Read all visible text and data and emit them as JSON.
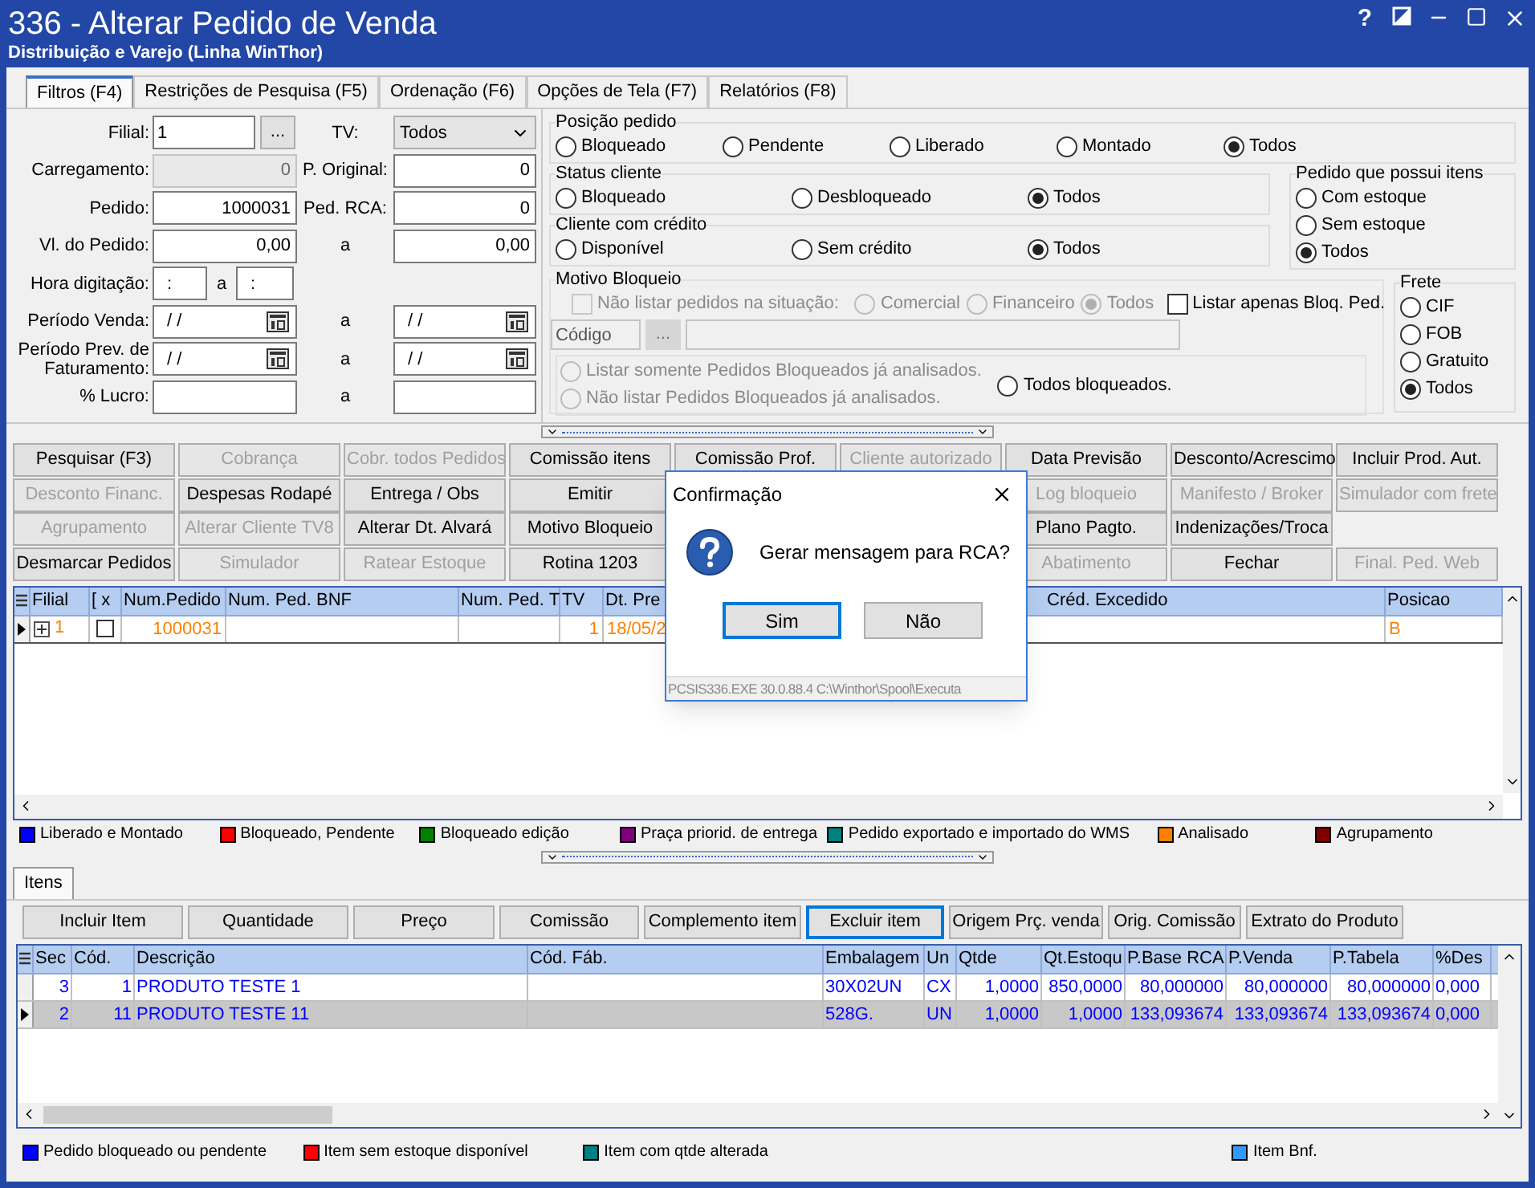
{
  "window": {
    "title": "336 - Alterar Pedido de Venda",
    "subtitle": "Distribuição e Varejo (Linha WinThor)",
    "help": "?"
  },
  "tabs": [
    {
      "label": "Filtros (F4)",
      "selected": true
    },
    {
      "label": "Restrições de Pesquisa (F5)",
      "selected": false
    },
    {
      "label": "Ordenação (F6)",
      "selected": false
    },
    {
      "label": "Opções de Tela (F7)",
      "selected": false
    },
    {
      "label": "Relatórios (F8)",
      "selected": false
    }
  ],
  "filters": {
    "rows": [
      {
        "label": "Filial:",
        "left": {
          "kind": "lookup",
          "value": "1",
          "button": "..."
        },
        "mid": "TV:",
        "right": {
          "kind": "select",
          "value": "Todos"
        }
      },
      {
        "label": "Carregamento:",
        "left": {
          "kind": "number",
          "value": "0",
          "disabled": true
        },
        "mid": "P. Original:",
        "right": {
          "kind": "number",
          "value": "0",
          "disabled": false
        }
      },
      {
        "label": "Pedido:",
        "left": {
          "kind": "number",
          "value": "1000031",
          "disabled": false
        },
        "mid": "Ped. RCA:",
        "right": {
          "kind": "number",
          "value": "0",
          "disabled": false
        }
      },
      {
        "label": "Vl. do Pedido:",
        "left": {
          "kind": "number",
          "value": "0,00",
          "disabled": false
        },
        "mid": "a",
        "right": {
          "kind": "number",
          "value": "0,00",
          "disabled": false
        }
      },
      {
        "label": "Hora digitação:",
        "left": {
          "kind": "time",
          "value": ":"
        },
        "mid": "a",
        "right": {
          "kind": "time",
          "value": ":"
        }
      },
      {
        "label": "Período Venda:",
        "left": {
          "kind": "date",
          "value": "/ /"
        },
        "mid": "a",
        "right": {
          "kind": "date",
          "value": "/ /"
        }
      },
      {
        "label": "Período Prev. de Faturamento:",
        "left": {
          "kind": "date",
          "value": "/ /"
        },
        "mid": "a",
        "right": {
          "kind": "date",
          "value": "/ /"
        }
      },
      {
        "label": "% Lucro:",
        "left": {
          "kind": "number",
          "disabled": false
        },
        "mid": "a",
        "right": {
          "kind": "number",
          "disabled": false
        }
      }
    ],
    "radio_groups": [
      {
        "title": "Posição pedido",
        "options": [
          {
            "label": "Bloqueado",
            "selected": false
          },
          {
            "label": "Pendente",
            "selected": false
          },
          {
            "label": "Liberado",
            "selected": false
          },
          {
            "label": "Montado",
            "selected": false
          },
          {
            "label": "Todos",
            "selected": true
          }
        ]
      },
      {
        "title": "Status cliente",
        "options": [
          {
            "label": "Bloqueado",
            "selected": false
          },
          {
            "label": "Desbloqueado",
            "selected": false
          },
          {
            "label": "Todos",
            "selected": true
          }
        ]
      },
      {
        "title": "Cliente com crédito",
        "options": [
          {
            "label": "Disponível",
            "selected": false
          },
          {
            "label": "Sem crédito",
            "selected": false
          },
          {
            "label": "Todos",
            "selected": true
          }
        ]
      },
      {
        "title": "Pedido que possui itens",
        "options": [
          {
            "label": "Com estoque",
            "selected": false
          },
          {
            "label": "Sem estoque",
            "selected": false
          },
          {
            "label": "Todos",
            "selected": true
          }
        ]
      },
      {
        "title": "Frete",
        "options": [
          {
            "label": "CIF",
            "selected": false
          },
          {
            "label": "FOB",
            "selected": false
          },
          {
            "label": "Gratuito",
            "selected": false
          },
          {
            "label": "Todos",
            "selected": true
          }
        ]
      }
    ],
    "motivo_bloqueio": {
      "title": "Motivo Bloqueio",
      "situacao": {
        "label": "Não listar pedidos na situação:",
        "checked": false,
        "disabled": true
      },
      "situacao_options": [
        {
          "label": "Comercial",
          "selected": false,
          "disabled": true
        },
        {
          "label": "Financeiro",
          "selected": false,
          "disabled": true
        },
        {
          "label": "Todos",
          "selected": true,
          "disabled": true
        }
      ],
      "bloq_ped": {
        "label": "Listar apenas Bloq. Ped.",
        "checked": false,
        "disabled": false
      },
      "codigo": {
        "placeholder": "Código",
        "button": "...",
        "disabled": true
      },
      "analysis_options": [
        {
          "label": "Listar somente Pedidos Bloqueados já analisados.",
          "selected": false,
          "disabled": true
        },
        {
          "label": "Não listar Pedidos Bloqueados já analisados.",
          "selected": false,
          "disabled": true
        },
        {
          "label": "Todos bloqueados.",
          "selected": false,
          "disabled": false
        }
      ]
    }
  },
  "actions": [
    {
      "left": [
        {
          "label": "Pesquisar (F3)",
          "disabled": false
        },
        {
          "label": "Cobrança",
          "disabled": true
        },
        {
          "label": "Cobr. todos Pedidos",
          "disabled": true
        },
        {
          "label": "Comissão itens",
          "disabled": false
        }
      ],
      "middle": [
        {
          "label": "Comissão Prof.",
          "disabled": false
        },
        {
          "label": "Cliente autorizado",
          "disabled": true
        }
      ],
      "right": [
        {
          "label": "Data Previsão",
          "disabled": false
        },
        {
          "label": "Desconto/Acrescimo",
          "disabled": false
        },
        {
          "label": "Incluir Prod. Aut.",
          "disabled": false
        }
      ]
    },
    {
      "left": [
        {
          "label": "Desconto Financ.",
          "disabled": true
        },
        {
          "label": "Despesas Rodapé",
          "disabled": false
        },
        {
          "label": "Entrega / Obs",
          "disabled": false
        },
        {
          "label": "Emitir",
          "disabled": false
        }
      ],
      "right": [
        {
          "label": "Log bloqueio",
          "disabled": true
        },
        {
          "label": "Manifesto / Broker",
          "disabled": true
        },
        {
          "label": "Simulador com frete",
          "disabled": true
        }
      ]
    },
    {
      "left": [
        {
          "label": "Agrupamento",
          "disabled": true
        },
        {
          "label": "Alterar Cliente TV8",
          "disabled": true
        },
        {
          "label": "Alterar Dt. Alvará",
          "disabled": false
        },
        {
          "label": "Motivo Bloqueio",
          "disabled": false
        }
      ],
      "right": [
        {
          "label": "Plano Pagto.",
          "disabled": false
        },
        {
          "label": "Indenizações/Troca",
          "disabled": false
        }
      ]
    },
    {
      "left": [
        {
          "label": "Desmarcar Pedidos",
          "disabled": false
        },
        {
          "label": "Simulador",
          "disabled": true
        },
        {
          "label": "Ratear Estoque",
          "disabled": true
        },
        {
          "label": "Rotina 1203",
          "disabled": false
        }
      ],
      "right": [
        {
          "label": "Abatimento",
          "disabled": true
        },
        {
          "label": "Fechar",
          "disabled": false
        },
        {
          "label": "Final. Ped. Web",
          "disabled": true
        }
      ]
    }
  ],
  "orders": {
    "columns": [
      "Filial",
      "[ x",
      "Num.Pedido",
      "Num. Ped. BNF",
      "Num. Ped. T",
      "TV",
      "Dt. Pre",
      "Créd. Excedido",
      "Posicao"
    ],
    "rows": [
      {
        "selected": true,
        "expanded": false,
        "checked": false,
        "color": "#ff8000",
        "cells": [
          "1",
          "",
          "1000031",
          "",
          "",
          "1",
          "18/05/2",
          "",
          "B"
        ]
      }
    ]
  },
  "legend": [
    {
      "label": "Liberado e Montado",
      "color": "#0000ff"
    },
    {
      "label": "Bloqueado, Pendente",
      "color": "#ff0000"
    },
    {
      "label": "Bloqueado edição",
      "color": "#008000"
    },
    {
      "label": "Praça priorid. de entrega",
      "color": "#800080"
    },
    {
      "label": "Pedido exportado e importado do WMS",
      "color": "#008080"
    },
    {
      "label": "Analisado",
      "color": "#ff8000"
    },
    {
      "label": "Agrupamento",
      "color": "#800000"
    }
  ],
  "items": {
    "tab": "Itens",
    "buttons": [
      {
        "label": "Incluir Item",
        "focused": false
      },
      {
        "label": "Quantidade",
        "focused": false
      },
      {
        "label": "Preço",
        "focused": false
      },
      {
        "label": "Comissão",
        "focused": false
      },
      {
        "label": "Complemento item",
        "focused": false
      },
      {
        "label": "Excluir item",
        "focused": true
      },
      {
        "label": "Origem Prç. venda",
        "focused": false
      },
      {
        "label": "Orig. Comissão",
        "focused": false
      },
      {
        "label": "Extrato do Produto",
        "focused": false
      }
    ],
    "columns": [
      "Sec",
      "Cód.",
      "Descrição",
      "Cód. Fáb.",
      "Embalagem",
      "Un",
      "Qtde",
      "Qt.Estoqu",
      "P.Base RCA",
      "P.Venda",
      "P.Tabela",
      "%Des"
    ],
    "rows": [
      {
        "selected": false,
        "color": "#0000ff",
        "cells": [
          "3",
          "1",
          "PRODUTO TESTE 1",
          "",
          "30X02UN",
          "CX",
          "1,0000",
          "850,0000",
          "80,000000",
          "80,000000",
          "80,000000",
          "0,000"
        ]
      },
      {
        "selected": true,
        "color": "#0000ff",
        "cells": [
          "2",
          "11",
          "PRODUTO TESTE 11",
          "",
          "528G.",
          "UN",
          "1,0000",
          "1,0000",
          "133,093674",
          "133,093674",
          "133,093674",
          "0,000"
        ]
      }
    ],
    "legend": [
      {
        "label": "Pedido bloqueado ou pendente",
        "color": "#0000ff"
      },
      {
        "label": "Item sem estoque disponível",
        "color": "#ff0000"
      },
      {
        "label": "Item com qtde alterada",
        "color": "#008080"
      },
      {
        "label": "Item Bnf.",
        "color": "#3399ff"
      }
    ]
  },
  "dialog": {
    "title": "Confirmação",
    "message": "Gerar mensagem para RCA?",
    "buttons": [
      {
        "label": "Sim",
        "default": true
      },
      {
        "label": "Não",
        "default": false
      }
    ],
    "footer": "PCSIS336.EXE 30.0.88.4 C:\\Winthor\\Spool\\Executa"
  }
}
